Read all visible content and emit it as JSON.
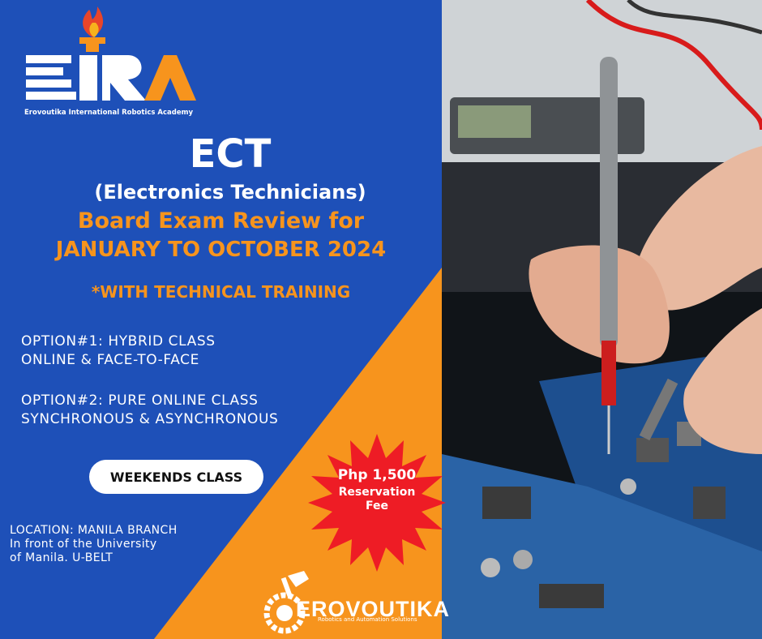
{
  "logo": {
    "letters": "EIRA",
    "subtitle": "Erovoutika International Robotics Academy"
  },
  "headline": {
    "title": "ECT",
    "subtitle": "(Electronics Technicians)",
    "line1": "Board Exam Review for",
    "line2": "JANUARY TO OCTOBER 2024",
    "note": "*WITH TECHNICAL TRAINING"
  },
  "options": [
    {
      "line1": "OPTION#1: HYBRID CLASS",
      "line2": "ONLINE & FACE-TO-FACE"
    },
    {
      "line1": "OPTION#2: PURE ONLINE CLASS",
      "line2": "SYNCHRONOUS & ASYNCHRONOUS"
    }
  ],
  "schedule_label": "WEEKENDS CLASS",
  "location": {
    "line1": "LOCATION: MANILA BRANCH",
    "line2": "In front of the University",
    "line3": "of Manila. U-BELT"
  },
  "fee": {
    "price": "Php 1,500",
    "line1": "Reservation",
    "line2": "Fee"
  },
  "brand": {
    "name": "EROVOUTIKA",
    "tagline": "Robotics and Automation Solutions"
  },
  "colors": {
    "blue": "#1e50b8",
    "orange": "#f7941d",
    "red": "#ee1c25",
    "white": "#ffffff"
  }
}
